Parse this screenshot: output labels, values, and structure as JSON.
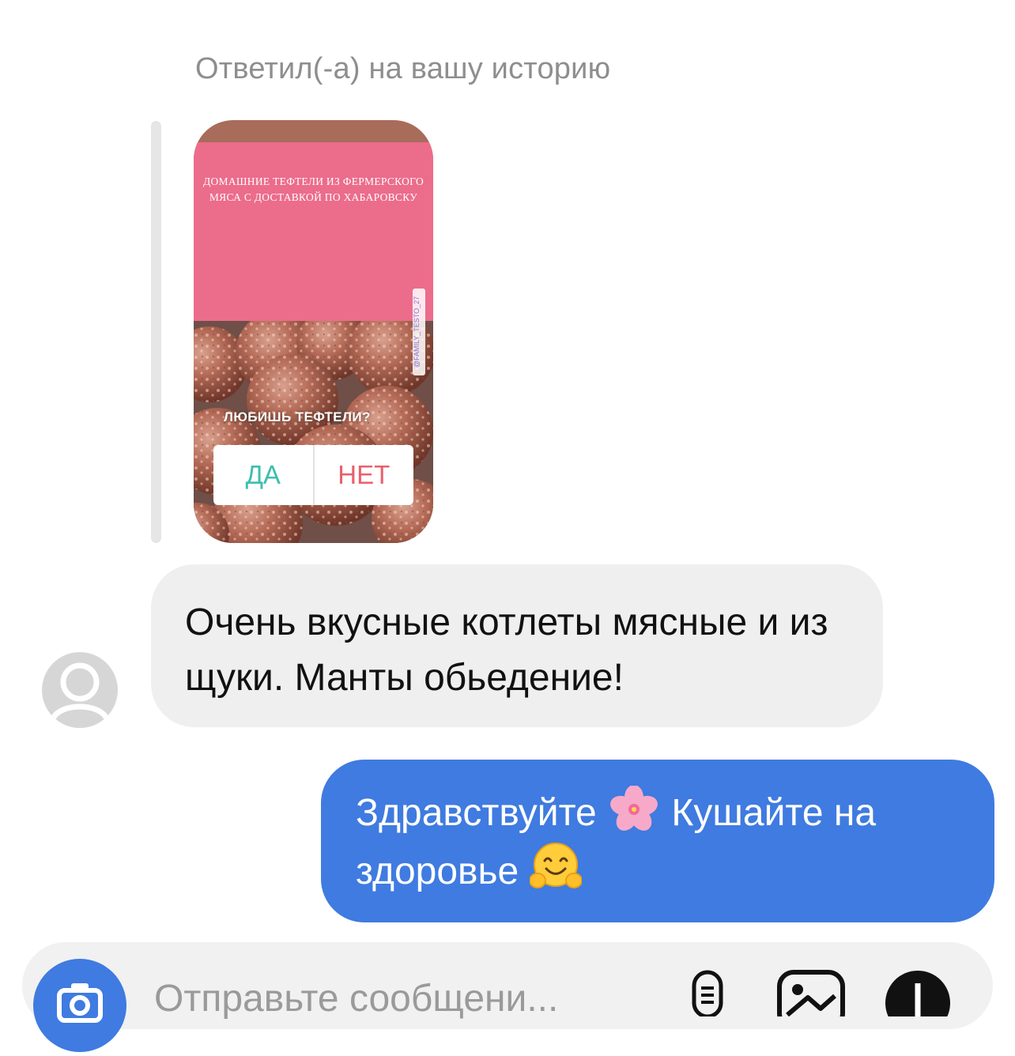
{
  "thread": {
    "reply_caption": "Ответил(-а) на вашу историю"
  },
  "story": {
    "banner_text": "Домашние тефтели из фермерского мяса с доставкой по Хабаровску",
    "question_text": "ЛЮБИШЬ ТЕФТЕЛИ?",
    "poll_yes_label": "ДА",
    "poll_no_label": "НЕТ",
    "watermark_text": "@FAMILY_TESTO_27",
    "colors": {
      "banner": "#ec6c8b",
      "card": "#a86c5a",
      "yes": "#3dbfae",
      "no": "#e8616b"
    }
  },
  "messages": [
    {
      "direction": "incoming",
      "text": "Очень вкусные котлеты мясные и из щуки. Манты обьедение!"
    },
    {
      "direction": "outgoing",
      "text_part1": "Здравствуйте",
      "emoji1": "cherry-blossom-emoji",
      "text_part2": "Кушайте на здоровье",
      "emoji2": "hugging-face-emoji"
    }
  ],
  "composer": {
    "placeholder": "Отправьте сообщени...",
    "icons": [
      "camera-icon",
      "microphone-icon",
      "gallery-icon",
      "sticker-icon"
    ]
  },
  "colors": {
    "outgoing_bubble": "#3f7be0",
    "incoming_bubble": "#efefef",
    "caption": "#8e8e8e"
  }
}
